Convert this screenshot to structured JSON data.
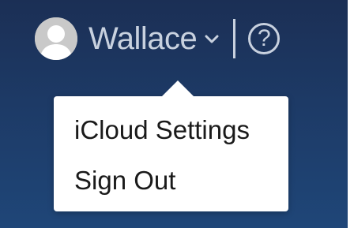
{
  "header": {
    "username": "Wallace",
    "help_glyph": "?",
    "icons": {
      "avatar": "default-user-avatar-icon",
      "chevron": "chevron-down-icon",
      "help": "question-mark-circle-icon"
    }
  },
  "dropdown": {
    "items": [
      {
        "label": "iCloud Settings"
      },
      {
        "label": "Sign Out"
      }
    ]
  },
  "colors": {
    "background_top": "#1b2f55",
    "background_bottom": "#1f4678",
    "header_text": "#c8d1df",
    "menu_background": "#ffffff",
    "menu_text": "#1a1a1a"
  }
}
